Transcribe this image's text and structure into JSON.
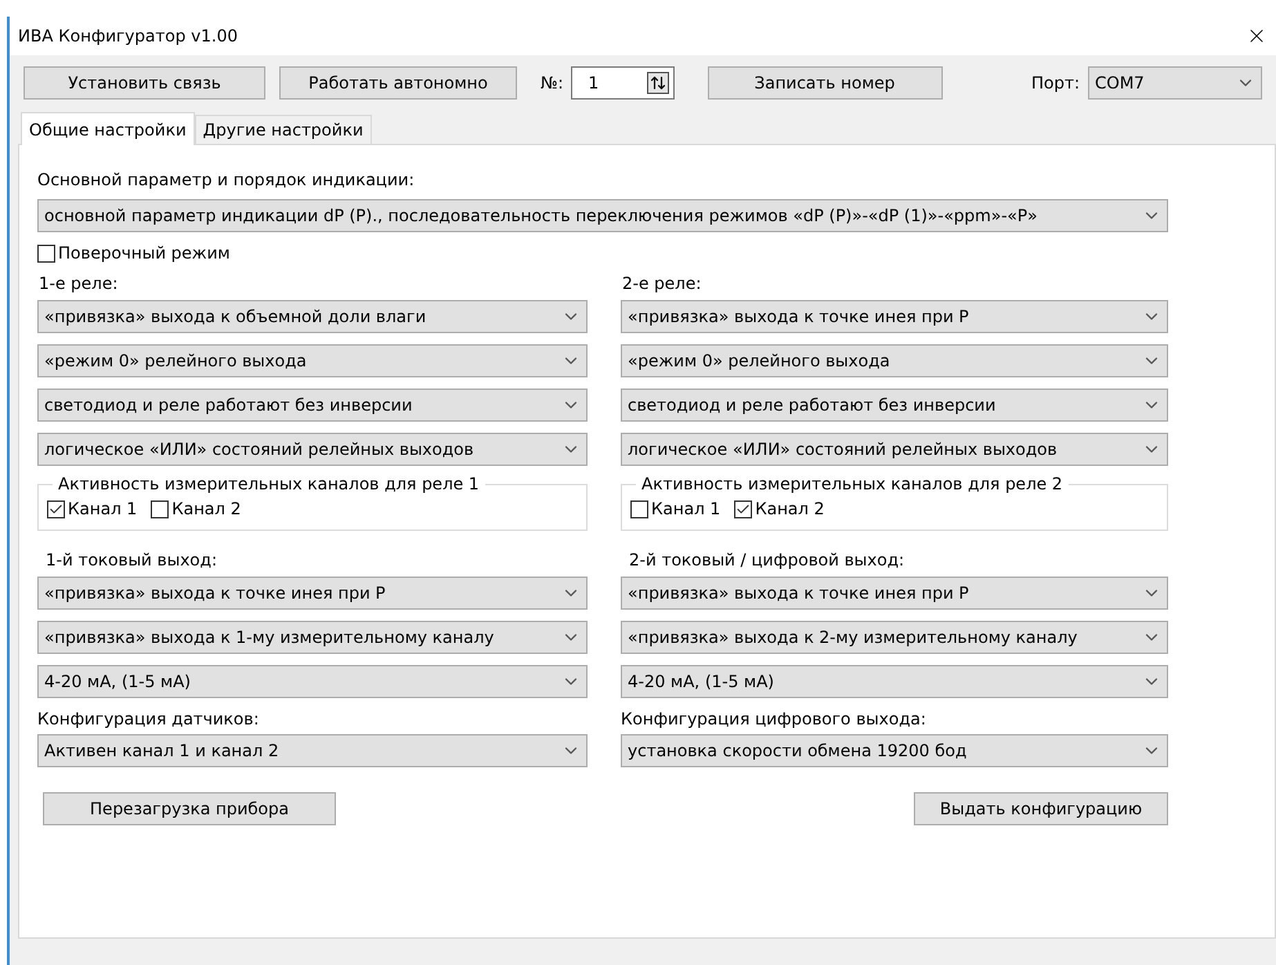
{
  "window": {
    "title": "ИВА Конфигуратор v1.00"
  },
  "toolbar": {
    "connect_button": "Установить связь",
    "offline_button": "Работать автономно",
    "number": {
      "label": "№:",
      "value": "1"
    },
    "write_button": "Записать номер",
    "port": {
      "label": "Порт:",
      "value": "COM7"
    }
  },
  "tabs": [
    {
      "label": "Общие настройки",
      "selected": true
    },
    {
      "label": "Другие настройки",
      "selected": false
    }
  ],
  "main_param": {
    "label": "Основной параметр и порядок индикации:",
    "value": "основной параметр индикации dP (P)., последовательность переключения режимов «dP (P)»-«dP (1)»-«ppm»-«P»"
  },
  "verification_mode": {
    "label": "Поверочный режим",
    "checked": false
  },
  "relays": [
    {
      "title": "1-е реле:",
      "selects": [
        "«привязка» выхода к объемной доли влаги",
        "«режим 0» релейного выхода",
        "светодиод и реле работают без инверсии",
        "логическое «ИЛИ» состояний релейных выходов"
      ],
      "group": {
        "title": "Активность измерительных каналов для реле 1",
        "channels": [
          {
            "label": "Канал 1",
            "checked": true
          },
          {
            "label": "Канал 2",
            "checked": false
          }
        ]
      }
    },
    {
      "title": "2-е реле:",
      "selects": [
        "«привязка» выхода к точке инея при Р",
        "«режим 0» релейного выхода",
        "светодиод и реле работают без инверсии",
        "логическое «ИЛИ» состояний релейных выходов"
      ],
      "group": {
        "title": "Активность измерительных каналов для реле 2",
        "channels": [
          {
            "label": "Канал 1",
            "checked": false
          },
          {
            "label": "Канал 2",
            "checked": true
          }
        ]
      }
    }
  ],
  "outputs": [
    {
      "title": "1-й токовый выход:",
      "selects": [
        "«привязка» выхода к точке инея при Р",
        "«привязка» выхода к 1-му измерительному каналу",
        "4-20 мА, (1-5 мА)"
      ]
    },
    {
      "title": "2-й токовый / цифровой выход:",
      "selects": [
        "«привязка» выхода к точке инея при Р",
        "«привязка» выхода к 2-му измерительному каналу",
        "4-20 мА, (1-5 мА)"
      ]
    }
  ],
  "configs": [
    {
      "title": "Конфигурация датчиков:",
      "value": "Активен канал 1 и канал 2"
    },
    {
      "title": "Конфигурация цифрового выхода:",
      "value": "установка скорости обмена 19200 бод"
    }
  ],
  "reboot_button": "Перезагрузка прибора",
  "send_button": "Выдать конфигурацию"
}
